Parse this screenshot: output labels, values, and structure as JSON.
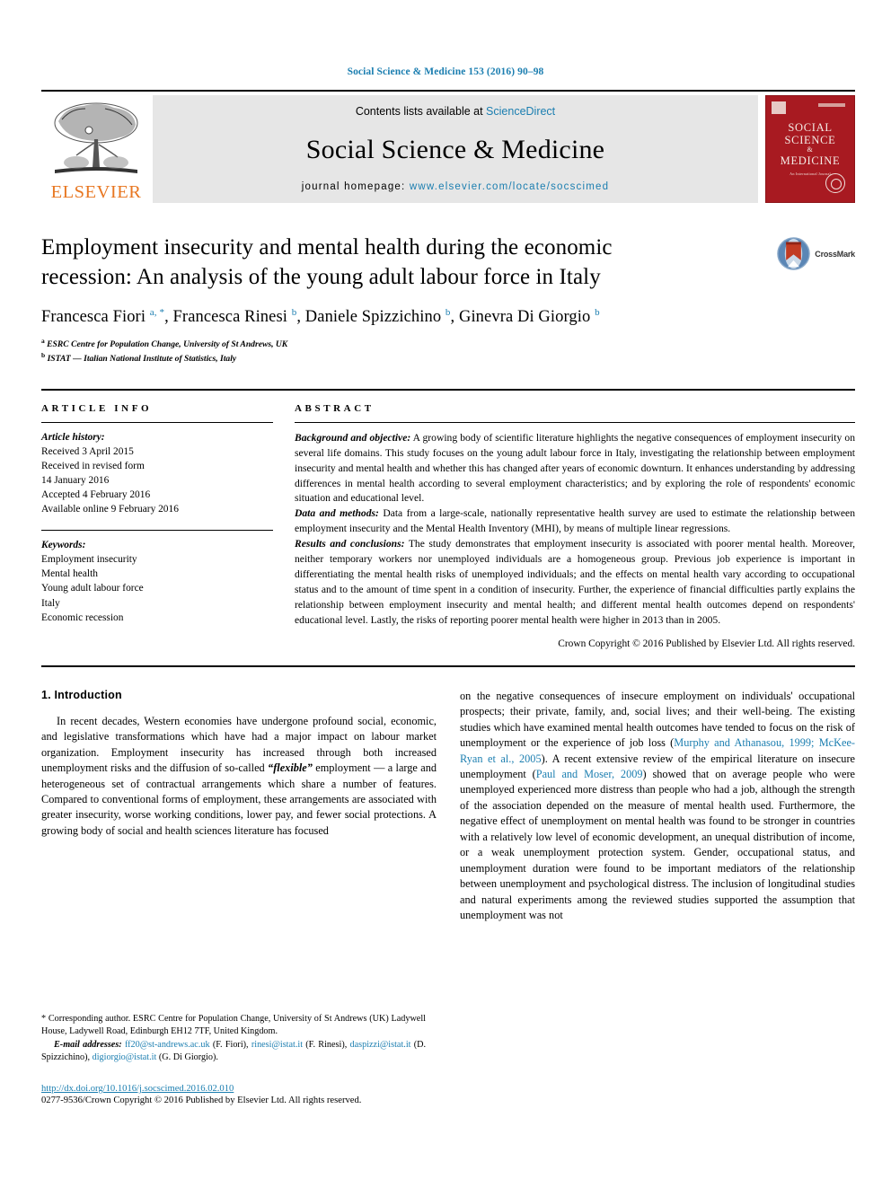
{
  "running_head": "Social Science & Medicine 153 (2016) 90–98",
  "masthead": {
    "contents_prefix": "Contents lists available at ",
    "sciencedirect": "ScienceDirect",
    "journal_title": "Social Science & Medicine",
    "homepage_prefix": "journal homepage: ",
    "homepage_url": "www.elsevier.com/locate/socscimed",
    "publisher": "ELSEVIER",
    "cover": {
      "line1": "SOCIAL",
      "line2": "SCIENCE",
      "amp": "&",
      "line3": "MEDICINE",
      "subtitle": "An International Journal"
    }
  },
  "article": {
    "title": "Employment insecurity and mental health during the economic recession: An analysis of the young adult labour force in Italy",
    "authors_html": "Francesca Fiori <sup>a, *</sup>, Francesca Rinesi <sup>b</sup>, Daniele Spizzichino <sup>b</sup>, Ginevra Di Giorgio <sup>b</sup>",
    "affiliation_a": "ESRC Centre for Population Change, University of St Andrews, UK",
    "affiliation_b": "ISTAT — Italian National Institute of Statistics, Italy",
    "crossmark_label": "CrossMark"
  },
  "info": {
    "heading": "ARTICLE INFO",
    "history_label": "Article history:",
    "history": [
      "Received 3 April 2015",
      "Received in revised form",
      "14 January 2016",
      "Accepted 4 February 2016",
      "Available online 9 February 2016"
    ],
    "keywords_label": "Keywords:",
    "keywords": [
      "Employment insecurity",
      "Mental health",
      "Young adult labour force",
      "Italy",
      "Economic recession"
    ]
  },
  "abstract": {
    "heading": "ABSTRACT",
    "p1_lead": "Background and objective:",
    "p1": " A growing body of scientific literature highlights the negative consequences of employment insecurity on several life domains. This study focuses on the young adult labour force in Italy, investigating the relationship between employment insecurity and mental health and whether this has changed after years of economic downturn. It enhances understanding by addressing differences in mental health according to several employment characteristics; and by exploring the role of respondents' economic situation and educational level.",
    "p2_lead": "Data and methods:",
    "p2": " Data from a large-scale, nationally representative health survey are used to estimate the relationship between employment insecurity and the Mental Health Inventory (MHI), by means of multiple linear regressions.",
    "p3_lead": "Results and conclusions:",
    "p3": " The study demonstrates that employment insecurity is associated with poorer mental health. Moreover, neither temporary workers nor unemployed individuals are a homogeneous group. Previous job experience is important in differentiating the mental health risks of unemployed individuals; and the effects on mental health vary according to occupational status and to the amount of time spent in a condition of insecurity. Further, the experience of financial difficulties partly explains the relationship between employment insecurity and mental health; and different mental health outcomes depend on respondents' educational level. Lastly, the risks of reporting poorer mental health were higher in 2013 than in 2005.",
    "copyright": "Crown Copyright © 2016 Published by Elsevier Ltd. All rights reserved."
  },
  "body": {
    "section_heading": "1. Introduction",
    "left_p1_a": "In recent decades, Western economies have undergone profound social, economic, and legislative transformations which have had a major impact on labour market organization. Employment insecurity has increased through both increased unemployment risks and the diffusion of so-called ",
    "left_p1_flex": "“flexible”",
    "left_p1_b": " employment — a large and heterogeneous set of contractual arrangements which share a number of features. Compared to conventional forms of employment, these arrangements are associated with greater insecurity, worse working conditions, lower pay, and fewer social protections. A growing body of social and health sciences literature has focused",
    "right_p1_a": "on the negative consequences of insecure employment on individuals' occupational prospects; their private, family, and, social lives; and their well-being. The existing studies which have examined mental health outcomes have tended to focus on the risk of unemployment or the experience of job loss (",
    "right_cite1": "Murphy and Athanasou, 1999; McKee-Ryan et al., 2005",
    "right_p1_b": "). A recent extensive review of the empirical literature on insecure unemployment (",
    "right_cite2": "Paul and Moser, 2009",
    "right_p1_c": ") showed that on average people who were unemployed experienced more distress than people who had a job, although the strength of the association depended on the measure of mental health used. Furthermore, the negative effect of unemployment on mental health was found to be stronger in countries with a relatively low level of economic development, an unequal distribution of income, or a weak unemployment protection system. Gender, occupational status, and unemployment duration were found to be important mediators of the relationship between unemployment and psychological distress. The inclusion of longitudinal studies and natural experiments among the reviewed studies supported the assumption that unemployment was not"
  },
  "footnotes": {
    "corresponding_marker": "*",
    "corresponding": " Corresponding author. ESRC Centre for Population Change, University of St Andrews (UK) Ladywell House, Ladywell Road, Edinburgh EH12 7TF, United Kingdom.",
    "email_label": "E-mail addresses:",
    "emails": [
      {
        "addr": "ff20@st-andrews.ac.uk",
        "name": " (F. Fiori), "
      },
      {
        "addr": "rinesi@istat.it",
        "name": " (F. Rinesi), "
      },
      {
        "addr": "daspizzi@istat.it",
        "name": " (D. Spizzichino), "
      },
      {
        "addr": "digiorgio@istat.it",
        "name": " (G. Di Giorgio)."
      }
    ],
    "doi": "http://dx.doi.org/10.1016/j.socscimed.2016.02.010",
    "issn": "0277-9536/Crown Copyright © 2016 Published by Elsevier Ltd. All rights reserved."
  },
  "colors": {
    "link": "#1b7eb0",
    "elsevier_orange": "#e87722",
    "cover_red": "#a81a21"
  }
}
